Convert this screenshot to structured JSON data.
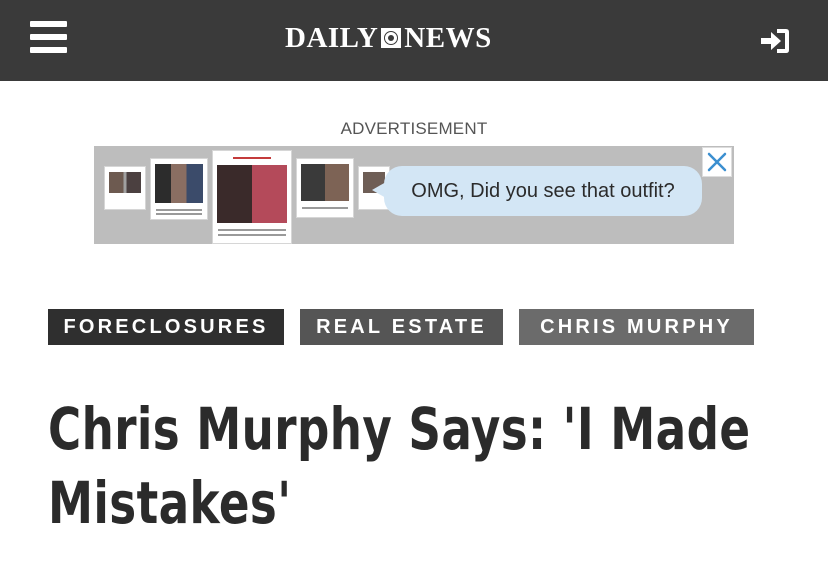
{
  "header": {
    "logo_left": "DAILY",
    "logo_right": "NEWS",
    "menu_icon": "hamburger-menu-icon",
    "signin_icon": "sign-in-icon",
    "background_color": "#3a3a3a"
  },
  "advertisement": {
    "label": "ADVERTISEMENT",
    "bubble_text": "OMG, Did you see that outfit?",
    "close_icon": "close-icon",
    "close_color": "#3b8fd0"
  },
  "tags": [
    {
      "label": "FORECLOSURES",
      "color": "#2f2f2f"
    },
    {
      "label": "REAL ESTATE",
      "color": "#555555"
    },
    {
      "label": "CHRIS MURPHY",
      "color": "#6b6b6b"
    }
  ],
  "article": {
    "headline": "Chris Murphy Says: 'I Made Mistakes'"
  }
}
